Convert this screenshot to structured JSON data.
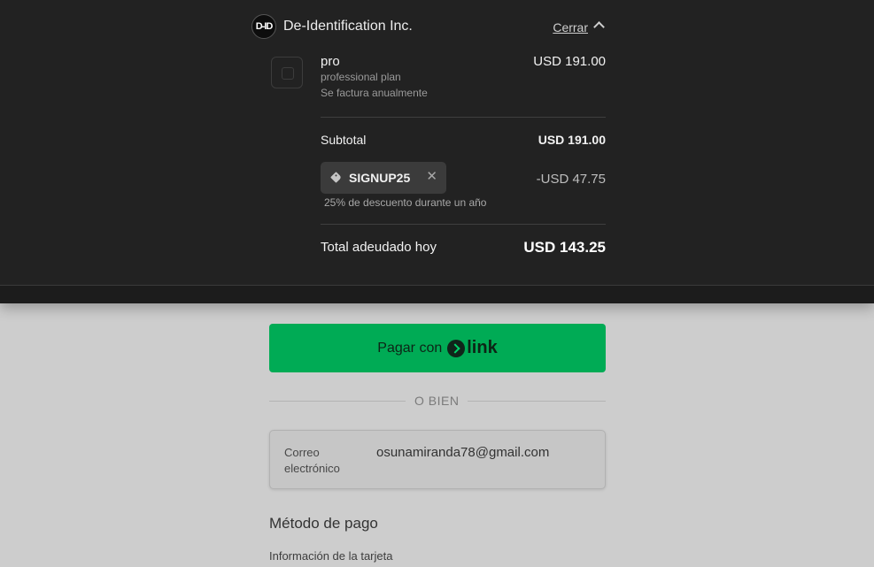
{
  "header": {
    "logo_text": "D-ID",
    "merchant_name": "De-Identification Inc.",
    "close_label": "Cerrar"
  },
  "product": {
    "name": "pro",
    "description": "professional plan",
    "billing_note": "Se factura anualmente",
    "price": "USD 191.00"
  },
  "subtotal": {
    "label": "Subtotal",
    "value": "USD 191.00"
  },
  "coupon": {
    "code": "SIGNUP25",
    "remove_symbol": "✕",
    "discount_amount": "-USD 47.75",
    "description": "25% de descuento durante un año"
  },
  "total": {
    "label": "Total adeudado hoy",
    "value": "USD 143.25"
  },
  "payment": {
    "link_button_prefix": "Pagar con",
    "link_brand": "link",
    "or_label": "O BIEN",
    "email_label": "Correo electrónico",
    "email_value": "osunamiranda78@gmail.com",
    "method_title": "Método de pago",
    "card_info_label": "Información de la tarjeta"
  },
  "colors": {
    "summary_background": "#222222",
    "page_background": "#cdcdcd",
    "link_green": "#00ab55"
  }
}
